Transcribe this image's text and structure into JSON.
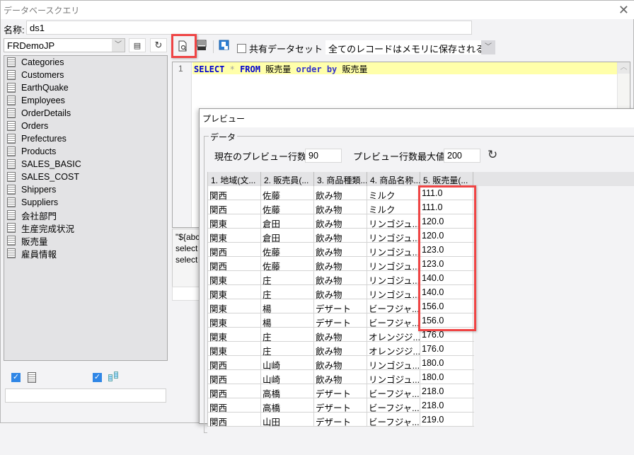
{
  "window": {
    "title": "データベースクエリ",
    "close_icon": "close-icon"
  },
  "name_field": {
    "label": "名称:",
    "value": "ds1"
  },
  "datasource": {
    "selected": "FRDemoJP"
  },
  "tables": [
    "Categories",
    "Customers",
    "EarthQuake",
    "Employees",
    "OrderDetails",
    "Orders",
    "Prefectures",
    "Products",
    "SALES_BASIC",
    "SALES_COST",
    "Shippers",
    "Suppliers",
    "会社部門",
    "生産完成状況",
    "販売量",
    "雇員情報"
  ],
  "toolbar": {
    "shared_dataset_label": "共有データセット",
    "shared_dataset_checked": false,
    "memory_option": "全てのレコードはメモリに保存される"
  },
  "editor": {
    "line_number": "1",
    "sql_tokens": {
      "select": "SELECT",
      "star": "*",
      "from": "FROM",
      "table": "販売量",
      "order": "order",
      "by": "by",
      "column": "販売量"
    }
  },
  "params_preview": {
    "lines": [
      "\"${abc",
      "select",
      "select"
    ]
  },
  "bottom_left": {
    "checkbox1_checked": true,
    "checkbox2_checked": true
  },
  "preview": {
    "title": "プレビュー",
    "group_label": "データ",
    "current_rows_label": "現在のプレビュー行数:",
    "current_rows_value": "90",
    "max_rows_label": "プレビュー行数最大値:",
    "max_rows_value": "200",
    "columns": [
      "1. 地域(文...",
      "2. 販売員(...",
      "3. 商品種類...",
      "4. 商品名称...",
      "5. 販売量(..."
    ],
    "rows": [
      [
        "関西",
        "佐藤",
        "飲み物",
        "ミルク",
        "111.0"
      ],
      [
        "関西",
        "佐藤",
        "飲み物",
        "ミルク",
        "111.0"
      ],
      [
        "関東",
        "倉田",
        "飲み物",
        "リンゴジュ...",
        "120.0"
      ],
      [
        "関東",
        "倉田",
        "飲み物",
        "リンゴジュ...",
        "120.0"
      ],
      [
        "関西",
        "佐藤",
        "飲み物",
        "リンゴジュ...",
        "123.0"
      ],
      [
        "関西",
        "佐藤",
        "飲み物",
        "リンゴジュ...",
        "123.0"
      ],
      [
        "関東",
        "庄",
        "飲み物",
        "リンゴジュ...",
        "140.0"
      ],
      [
        "関東",
        "庄",
        "飲み物",
        "リンゴジュ...",
        "140.0"
      ],
      [
        "関東",
        "楊",
        "デザート",
        "ビーフジャ...",
        "156.0"
      ],
      [
        "関東",
        "楊",
        "デザート",
        "ビーフジャ...",
        "156.0"
      ],
      [
        "関東",
        "庄",
        "飲み物",
        "オレンジジ...",
        "176.0"
      ],
      [
        "関東",
        "庄",
        "飲み物",
        "オレンジジ...",
        "176.0"
      ],
      [
        "関西",
        "山崎",
        "飲み物",
        "リンゴジュ...",
        "180.0"
      ],
      [
        "関西",
        "山崎",
        "飲み物",
        "リンゴジュ...",
        "180.0"
      ],
      [
        "関西",
        "高橋",
        "デザート",
        "ビーフジャ...",
        "218.0"
      ],
      [
        "関西",
        "高橋",
        "デザート",
        "ビーフジャ...",
        "218.0"
      ],
      [
        "関西",
        "山田",
        "デザート",
        "ビーフジャ...",
        "219.0"
      ]
    ]
  },
  "colors": {
    "highlight": "#ef4444",
    "keyword": "#0000d0",
    "current_line": "#ffffaa",
    "checkbox": "#2f86e6"
  }
}
